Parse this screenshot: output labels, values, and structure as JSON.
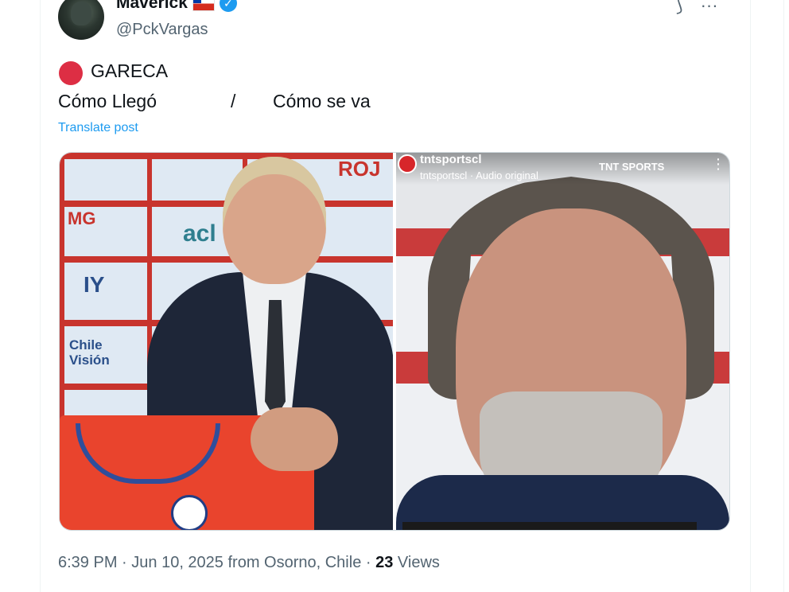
{
  "author": {
    "display_name": "Maverick",
    "handle": "@PckVargas",
    "verified_icon": "verified-badge-icon",
    "flag_icon": "chile-flag-icon"
  },
  "actions": {
    "grok_icon": "grok-icon",
    "more_icon": "more-icon",
    "more_glyph": "···",
    "grok_glyph": "⟆"
  },
  "post": {
    "emoji_icon": "red-circle-icon",
    "heading": "GARECA",
    "left_caption": "Cómo Llegó",
    "separator": "/",
    "right_caption": "Cómo se va",
    "translate_label": "Translate post"
  },
  "media": {
    "left_photo": {
      "sponsors": [
        "acl",
        "Chile Visión",
        "IY",
        "ROJ",
        "MG"
      ]
    },
    "right_photo": {
      "channel": "tntsportscl",
      "audio": "tntsportscl · Audio original",
      "broadcaster": "TNT SPORTS",
      "more_glyph": "⋮"
    }
  },
  "footer": {
    "time": "6:39 PM",
    "date": "Jun 10, 2025",
    "location": "from Osorno, Chile",
    "views_count": "23",
    "views_label": "Views"
  },
  "colors": {
    "accent": "#1d9bf0",
    "text_primary": "#0f1419",
    "text_secondary": "#536471",
    "red_circle": "#dd2e44"
  }
}
